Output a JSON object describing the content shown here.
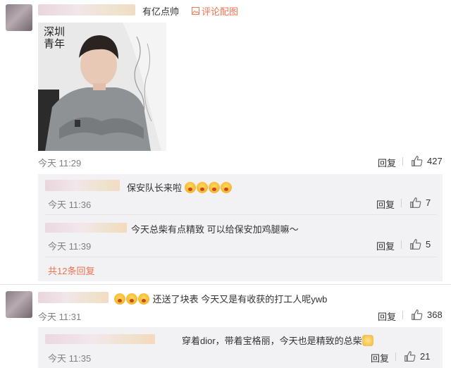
{
  "top": {
    "username": "有亿点帅",
    "action_label": "评论配图",
    "photo_caption": [
      "深圳",
      "青年"
    ]
  },
  "comments": [
    {
      "time": "今天 11:29",
      "reply_label": "回复",
      "likes": "427",
      "replies": [
        {
          "text": "保安队长来啦",
          "emoji_count": 4,
          "time": "今天 11:36",
          "reply_label": "回复",
          "likes": "7"
        },
        {
          "text": "今天总柴有点精致  可以给保安加鸡腿嘛～",
          "time": "今天 11:39",
          "reply_label": "回复",
          "likes": "5"
        }
      ],
      "more_replies": "共12条回复"
    },
    {
      "text": "还送了块表 今天又是有收获的打工人呢ywb",
      "emoji_count": 3,
      "time": "今天 11:31",
      "reply_label": "回复",
      "likes": "368",
      "replies": [
        {
          "text": "穿着dior，带着宝格丽，今天也是精致的总柴",
          "time": "今天 11:35",
          "reply_label": "回复",
          "likes": "21"
        }
      ]
    }
  ],
  "colors": {
    "link": "#eb7350",
    "meta": "#808080",
    "subbox": "#f2f2f5"
  }
}
